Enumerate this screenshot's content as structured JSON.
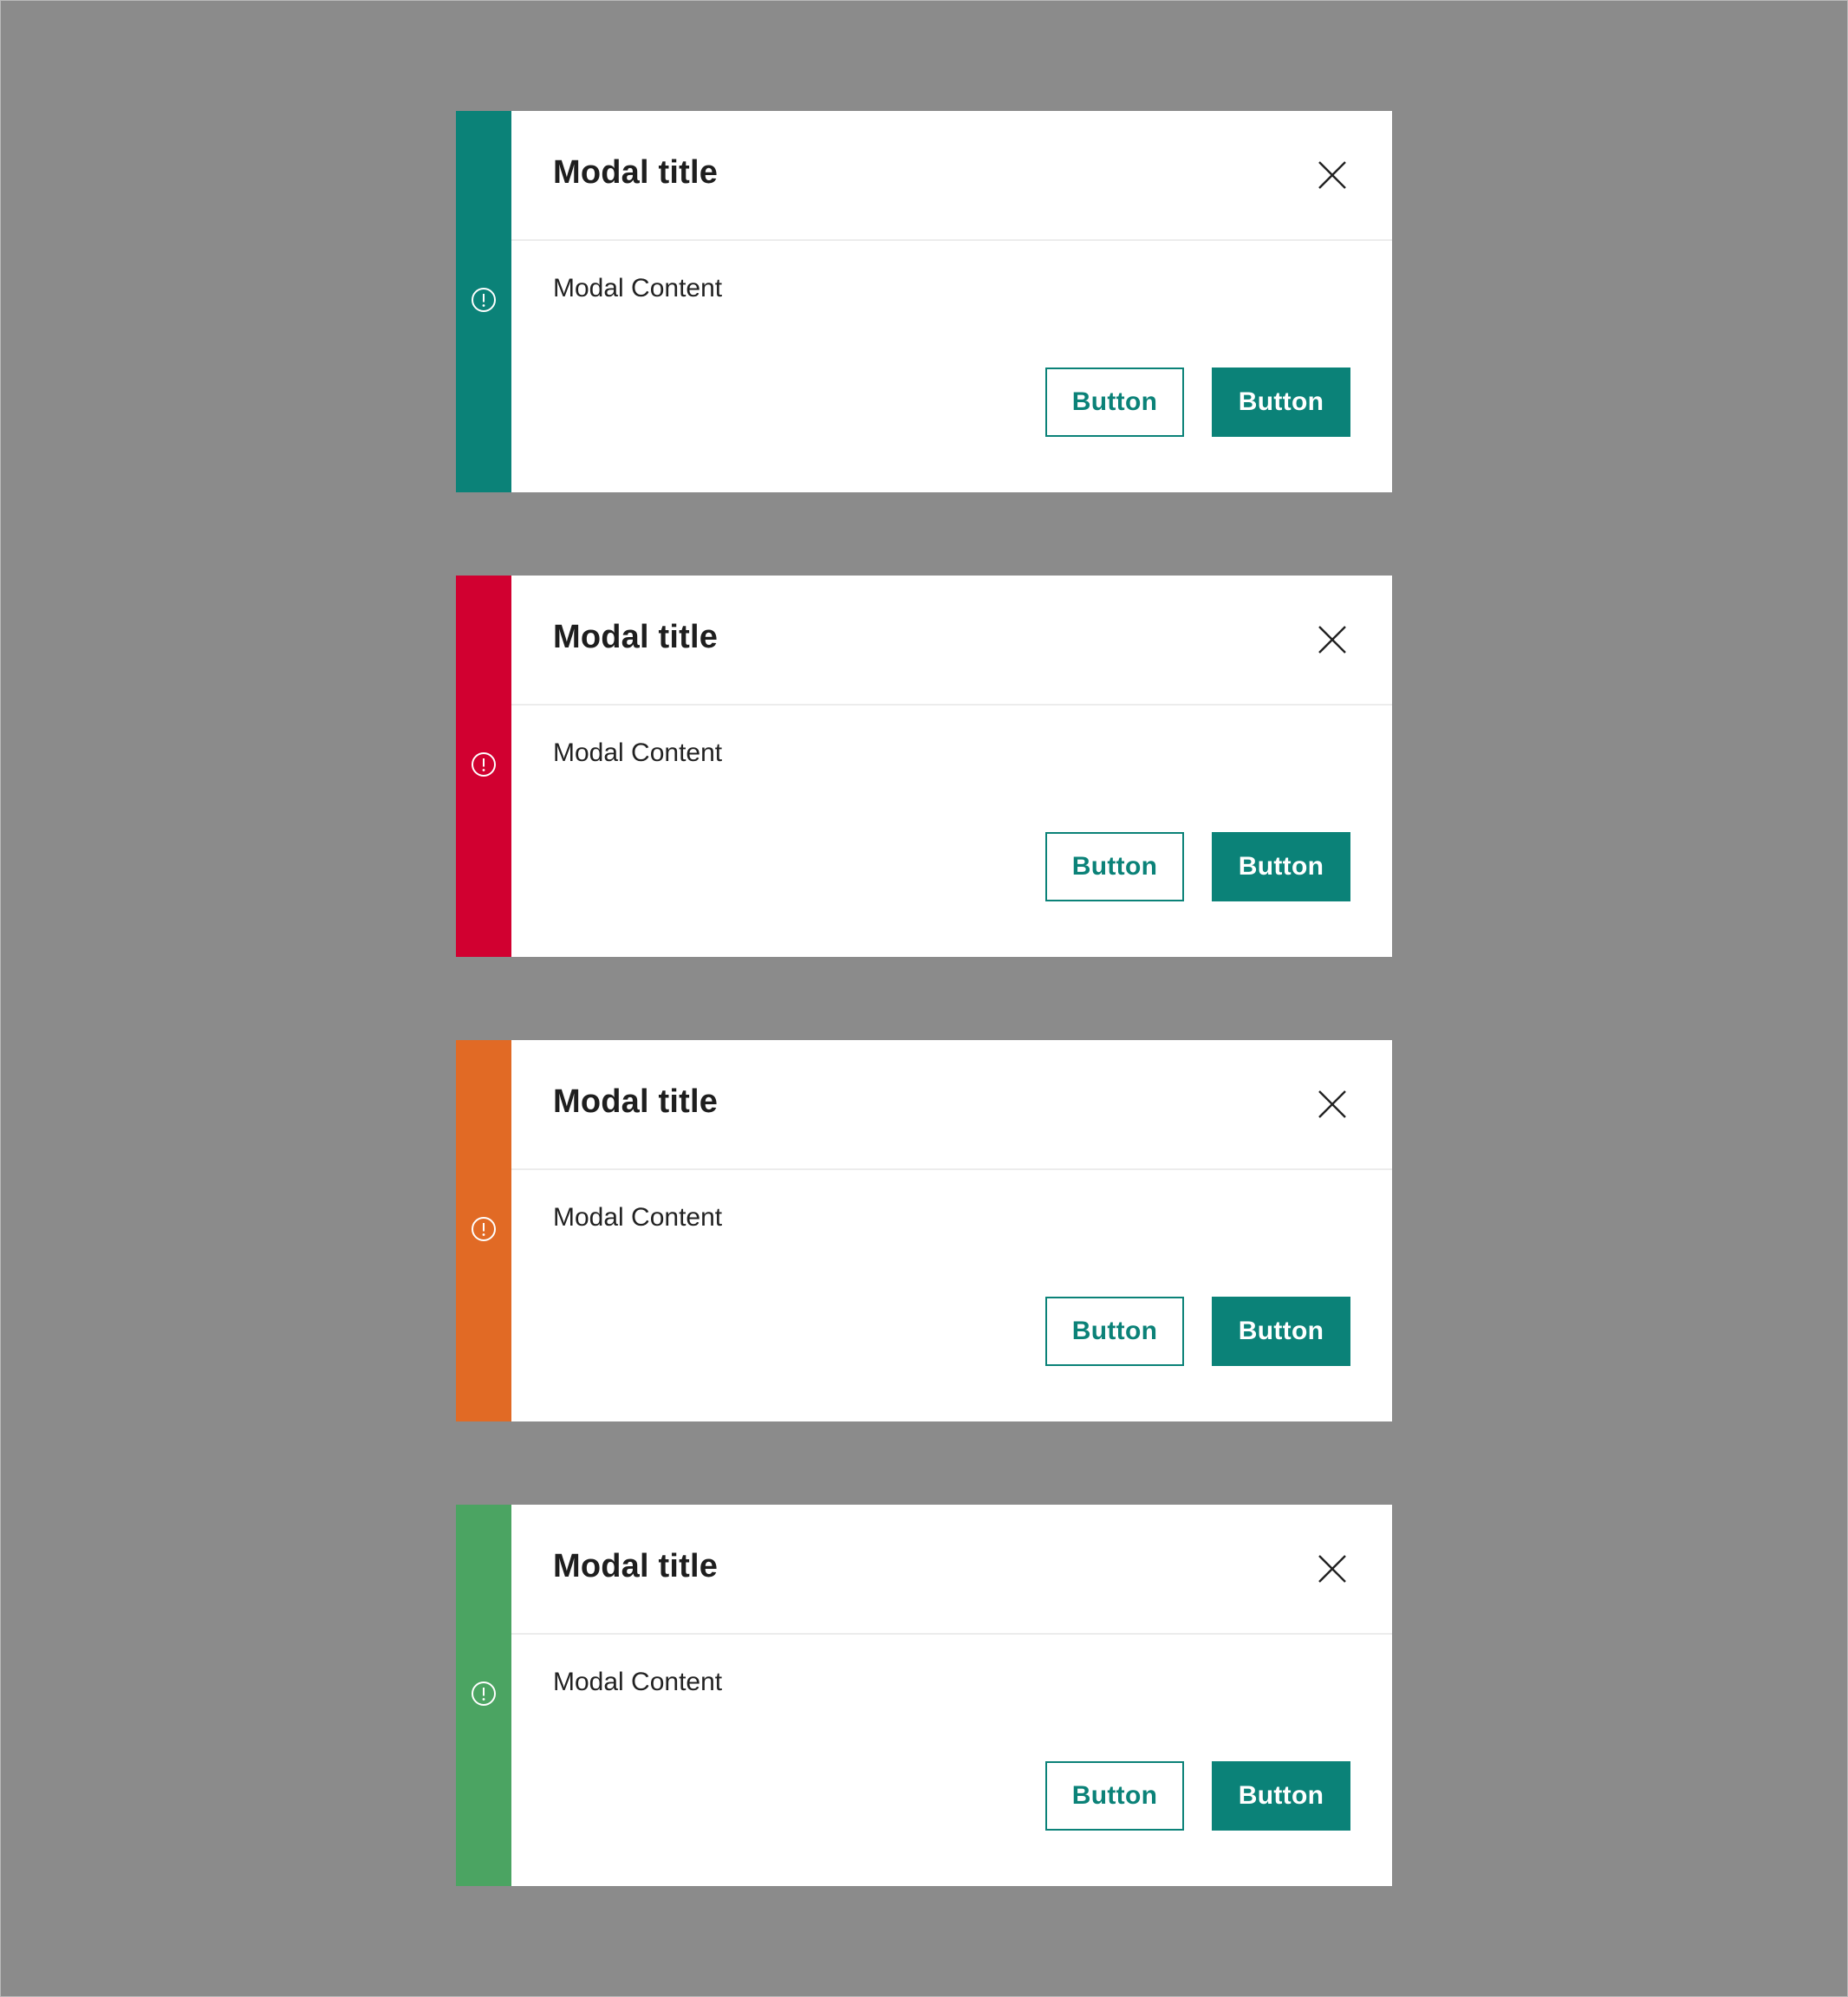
{
  "modals": [
    {
      "variant": "teal",
      "accent_color": "#0b8278",
      "status_icon": "alert-circle-icon",
      "title": "Modal title",
      "content": "Modal Content",
      "close_icon": "close-icon",
      "secondary_button_label": "Button",
      "primary_button_label": "Button"
    },
    {
      "variant": "red",
      "accent_color": "#d10030",
      "status_icon": "alert-circle-icon",
      "title": "Modal title",
      "content": "Modal Content",
      "close_icon": "close-icon",
      "secondary_button_label": "Button",
      "primary_button_label": "Button"
    },
    {
      "variant": "orange",
      "accent_color": "#e16a25",
      "status_icon": "alert-circle-icon",
      "title": "Modal title",
      "content": "Modal Content",
      "close_icon": "close-icon",
      "secondary_button_label": "Button",
      "primary_button_label": "Button"
    },
    {
      "variant": "green",
      "accent_color": "#4ba462",
      "status_icon": "alert-circle-icon",
      "title": "Modal title",
      "content": "Modal Content",
      "close_icon": "close-icon",
      "secondary_button_label": "Button",
      "primary_button_label": "Button"
    }
  ],
  "colors": {
    "background": "#8b8b8b",
    "button_primary": "#0b8278",
    "button_primary_text": "#ffffff",
    "title_text": "#1e1e1e"
  }
}
